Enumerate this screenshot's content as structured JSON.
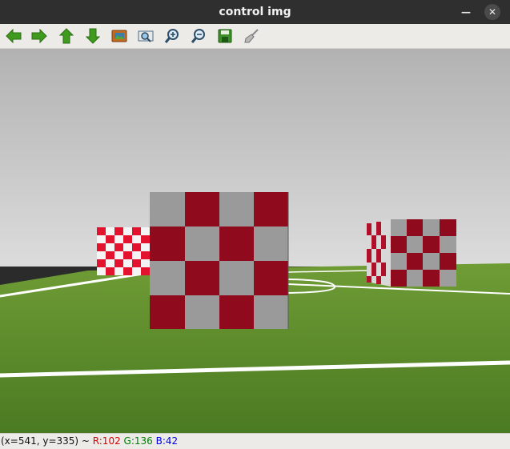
{
  "window": {
    "title": "control img"
  },
  "toolbar": {
    "tools": [
      {
        "name": "back-arrow-icon"
      },
      {
        "name": "forward-arrow-icon"
      },
      {
        "name": "up-arrow-icon"
      },
      {
        "name": "down-arrow-icon"
      },
      {
        "name": "image-icon"
      },
      {
        "name": "zoom-fit-icon"
      },
      {
        "name": "zoom-in-icon"
      },
      {
        "name": "zoom-out-icon"
      },
      {
        "name": "save-icon"
      },
      {
        "name": "brush-icon"
      }
    ]
  },
  "status": {
    "coords": "(x=541, y=335) ~ ",
    "r": "R:102",
    "g": "G:136",
    "b": "B:42"
  },
  "colors": {
    "sky": "#b4b4b4",
    "grass": "#5a8a2a",
    "field_line": "#ffffff",
    "checker_red": "#8f0a1c",
    "checker_gray": "#9a9a9a",
    "checker_bright_red": "#e3132f",
    "checker_white": "#f4f4f4",
    "arrow_green": "#3f9b1d"
  }
}
